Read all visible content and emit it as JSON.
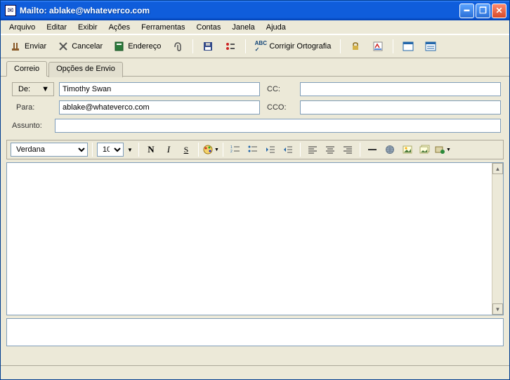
{
  "window": {
    "title": "Mailto: ablake@whateverco.com"
  },
  "menu": {
    "items": [
      "Arquivo",
      "Editar",
      "Exibir",
      "Ações",
      "Ferramentas",
      "Contas",
      "Janela",
      "Ajuda"
    ]
  },
  "toolbar": {
    "send": "Enviar",
    "cancel": "Cancelar",
    "address": "Endereço",
    "spell": "Corrigir Ortografia"
  },
  "tabs": {
    "mail": "Correio",
    "send_options": "Opções de Envio"
  },
  "headers": {
    "from_label": "De:",
    "from_value": "Timothy Swan",
    "to_label": "Para:",
    "to_value": "ablake@whateverco.com",
    "cc_label": "CC:",
    "cc_value": "",
    "bcc_label": "CCO:",
    "bcc_value": "",
    "subject_label": "Assunto:",
    "subject_value": ""
  },
  "format": {
    "font": "Verdana",
    "size": "10"
  },
  "body": ""
}
